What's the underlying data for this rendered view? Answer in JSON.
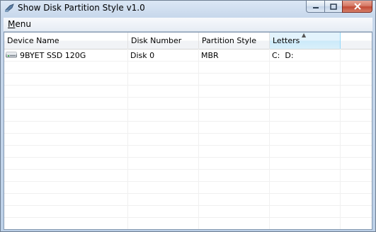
{
  "window": {
    "title": "Show Disk Partition Style v1.0"
  },
  "menubar": {
    "menu_label": "Menu",
    "menu_first_letter": "M",
    "menu_rest": "enu"
  },
  "listview": {
    "columns": [
      {
        "label": "Device Name"
      },
      {
        "label": "Disk Number"
      },
      {
        "label": "Partition Style"
      },
      {
        "label": "Letters",
        "sorted": "ascending"
      }
    ],
    "rows": [
      {
        "device": "9BYET SSD 120G",
        "disk_number": "Disk 0",
        "partition_style": "MBR",
        "letters": "C:  D:",
        "icon": "hard-drive-icon"
      }
    ]
  },
  "colors": {
    "sorted_header": "#cce9f9",
    "close_button": "#c24a35"
  }
}
